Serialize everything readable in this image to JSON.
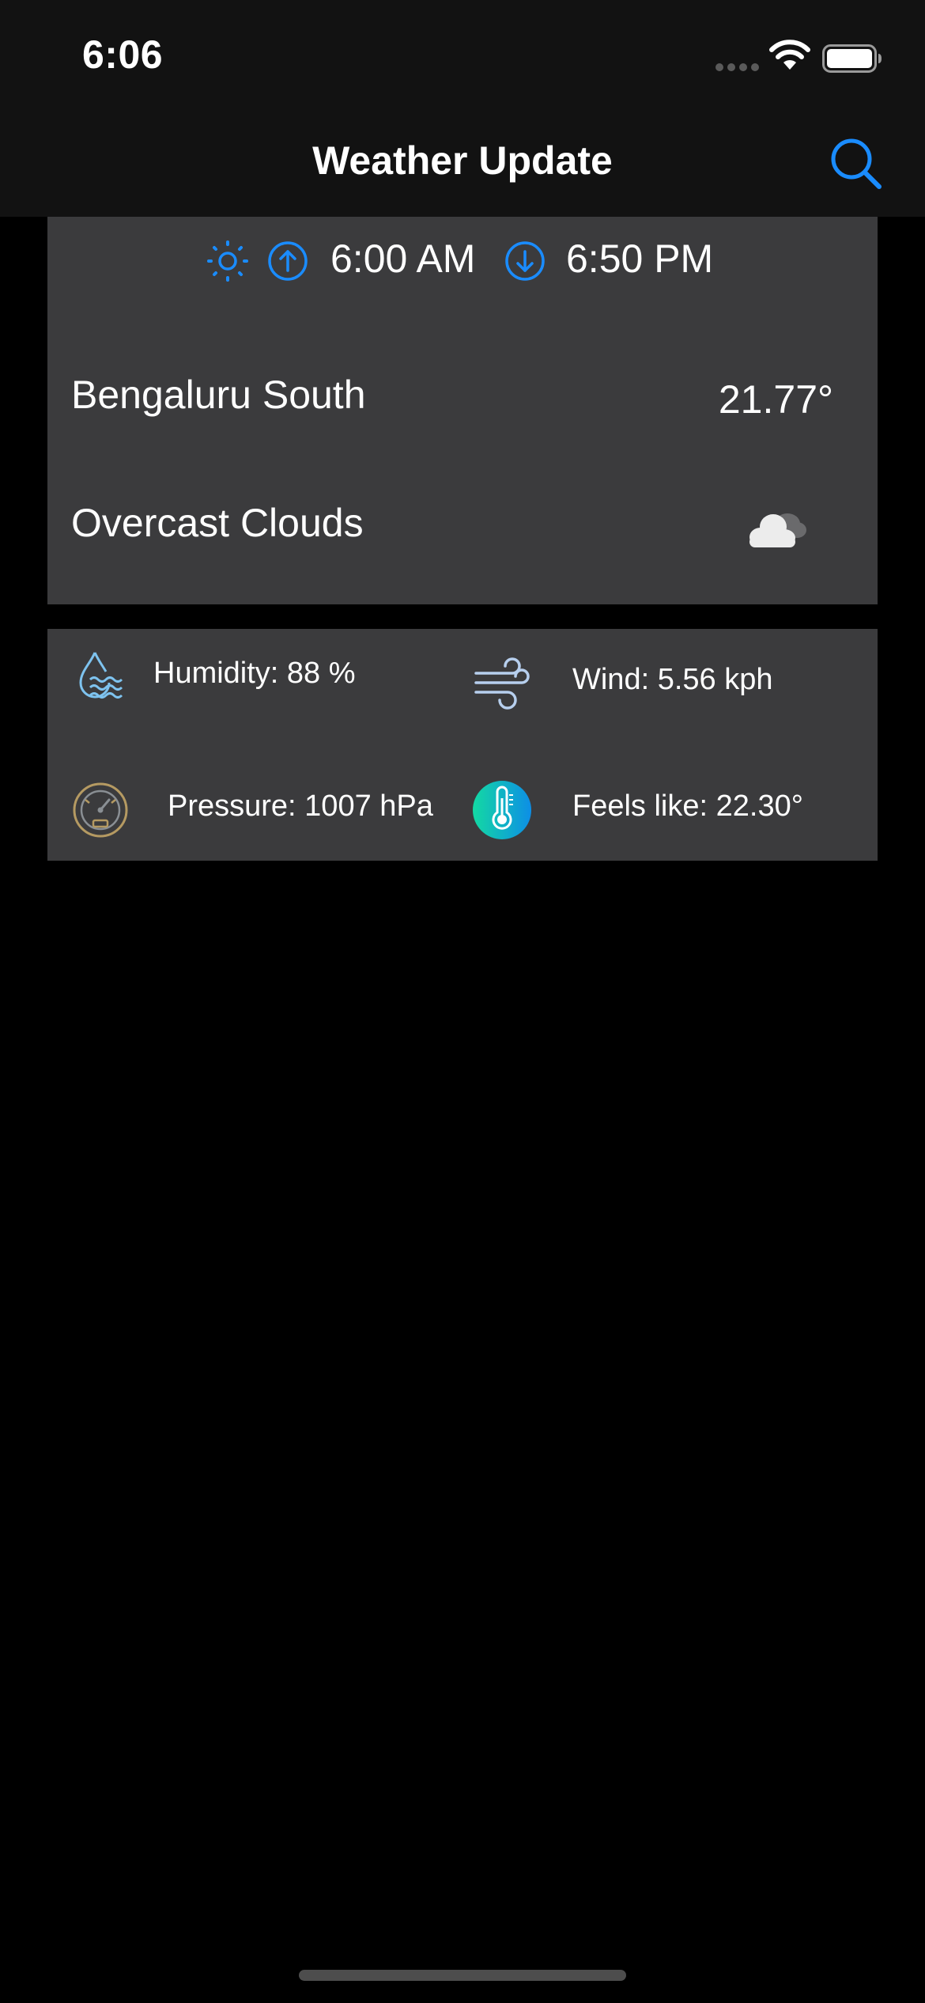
{
  "status_bar": {
    "time": "6:06"
  },
  "nav": {
    "title": "Weather Update"
  },
  "sun": {
    "sunrise": "6:00 AM",
    "sunset": "6:50 PM"
  },
  "weather": {
    "city": "Bengaluru South",
    "temperature": "21.77°",
    "condition": "Overcast Clouds"
  },
  "details": {
    "humidity": "Humidity: 88 %",
    "wind": "Wind: 5.56 kph",
    "pressure": "Pressure: 1007 hPa",
    "feels_like": "Feels like: 22.30°"
  },
  "colors": {
    "accent": "#1a8cff",
    "card_background": "#3b3b3d",
    "bar_background": "#121212"
  },
  "icons": {
    "sun": "sun-icon",
    "sunrise": "arrow-up-circle-icon",
    "sunset": "arrow-down-circle-icon",
    "condition": "cloud-icon",
    "humidity": "water-drop-icon",
    "wind": "wind-icon",
    "pressure": "gauge-icon",
    "feels_like": "thermometer-icon",
    "search": "search-icon"
  }
}
